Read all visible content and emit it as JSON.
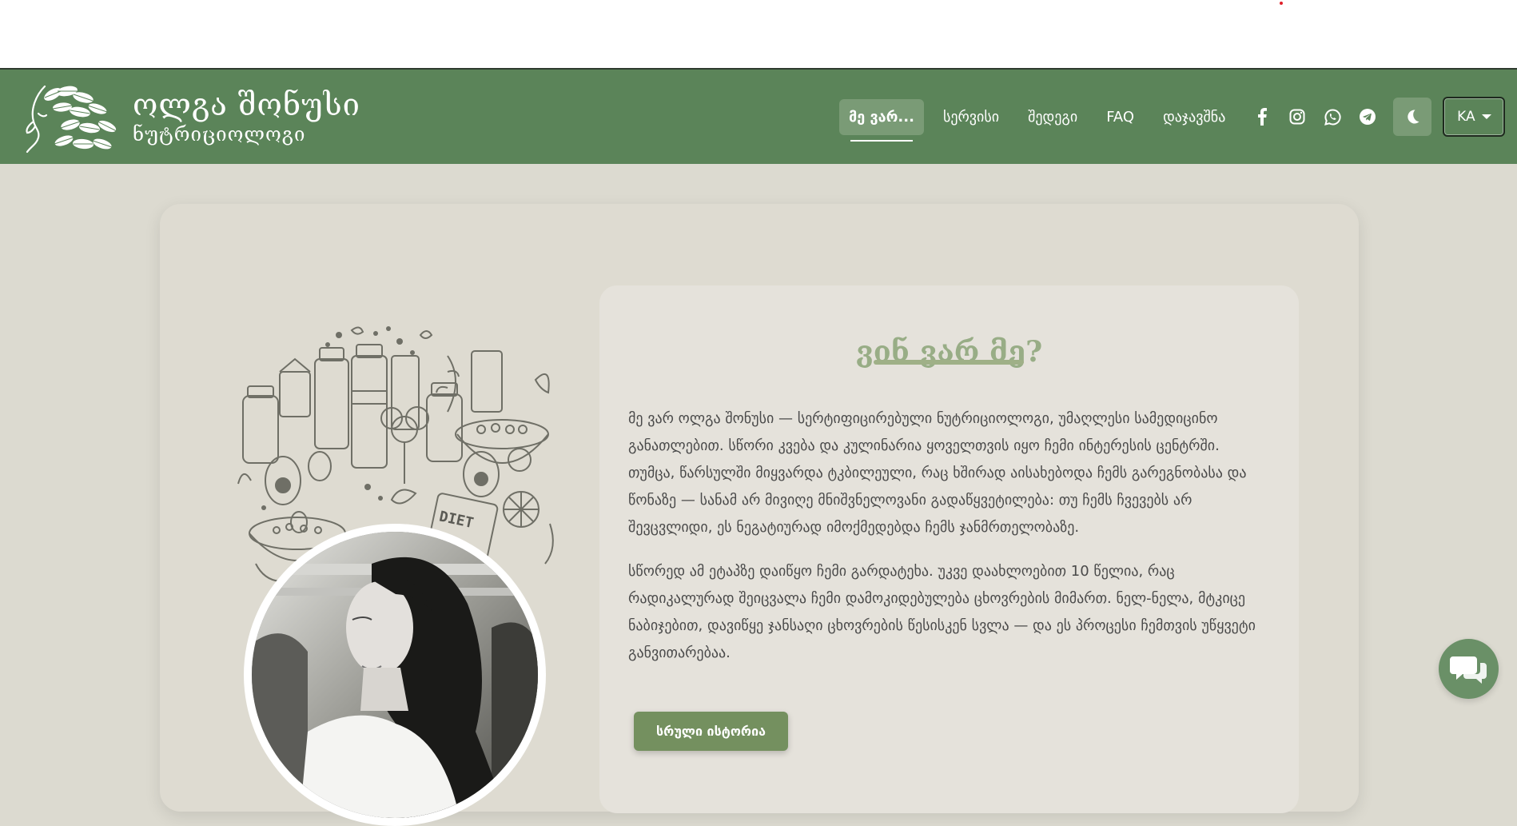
{
  "brand": {
    "name": "ოლგა შონუსი",
    "subtitle": "ნუტრიციოლოგი"
  },
  "nav": {
    "items": [
      {
        "label": "მე ვარ...",
        "active": true
      },
      {
        "label": "სერვისი",
        "active": false
      },
      {
        "label": "შედეგი",
        "active": false
      },
      {
        "label": "FAQ",
        "active": false
      },
      {
        "label": "დაჯავშნა",
        "active": false
      }
    ],
    "social_icons": [
      "facebook-icon",
      "instagram-icon",
      "whatsapp-icon",
      "telegram-icon"
    ],
    "theme_toggle_icon": "moon-icon",
    "language": "KA"
  },
  "about": {
    "title": "ვინ ვარ მე?",
    "paragraphs": [
      "მე ვარ ოლგა შონუსი — სერტიფიცირებული ნუტრიციოლოგი, უმაღლესი სამედიცინო განათლებით. სწორი კვება და კულინარია ყოველთვის იყო ჩემი ინტერესის ცენტრში. თუმცა, წარსულში მიყვარდა ტკბილეული, რაც ხშირად აისახებოდა ჩემს გარეგნობასა და წონაზე — სანამ არ მივიღე მნიშვნელოვანი გადაწყვეტილება: თუ ჩემს ჩვევებს არ შევცვლიდი, ეს ნეგატიურად იმოქმედებდა ჩემს ჯანმრთელობაზე.",
      "სწორედ ამ ეტაპზე დაიწყო ჩემი გარდატეხა. უკვე დაახლოებით 10 წელია, რაც რადიკალურად შეიცვალა ჩემი დამოკიდებულება ცხოვრების მიმართ. ნელ-ნელა, მტკიცე ნაბიჯებით, დავიწყე ჯანსაღი ცხოვრების წესისკენ სვლა — და ეს პროცესი ჩემთვის უწყვეტი განვითარებაა."
    ],
    "button_label": "სრული ისტორია",
    "illustration_label": "DIET"
  },
  "colors": {
    "nav_bg": "#5b8459",
    "page_bg": "#dcdad0",
    "title": "#98ad86",
    "button": "#74905f",
    "chat_button": "#6a9067"
  },
  "chat_icon": "chat-bubbles-icon"
}
